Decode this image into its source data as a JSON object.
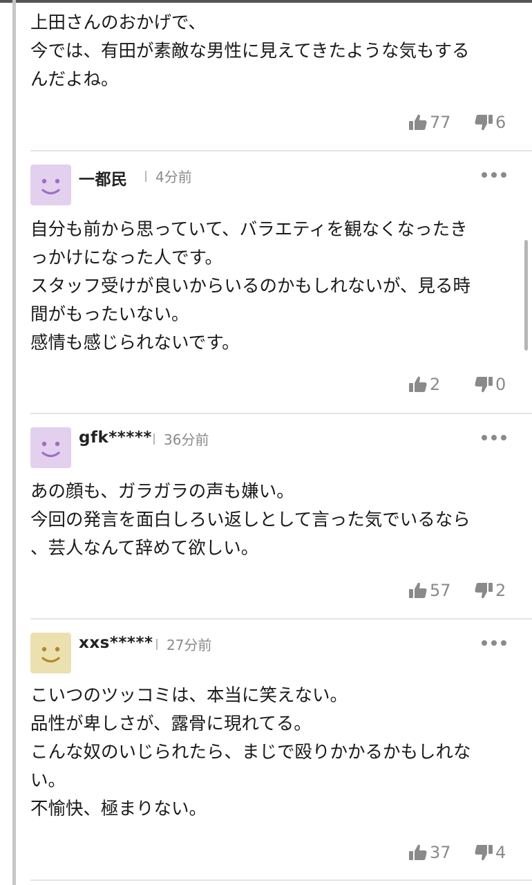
{
  "comments": [
    {
      "lines": [
        "上田さんのおかげで、",
        "今では、有田が素敵な男性に見えてきたような気もする",
        "んだよね。"
      ],
      "likes": "77",
      "dislikes": "6"
    },
    {
      "user": "一都民",
      "time": "4分前",
      "avatar_color": "#e3d0ee",
      "face_color": "#9c6ec6",
      "lines": [
        "自分も前から思っていて、バラエティを観なくなったき",
        "っかけになった人です。",
        "スタッフ受けが良いからいるのかもしれないが、見る時",
        "間がもったいない。",
        "感情も感じられないです。"
      ],
      "likes": "2",
      "dislikes": "0"
    },
    {
      "user": "gfk*****",
      "time": "36分前",
      "avatar_color": "#e3d0ee",
      "face_color": "#9c6ec6",
      "lines": [
        "あの顔も、ガラガラの声も嫌い。",
        "今回の発言を面白しろい返しとして言った気でいるなら",
        "、芸人なんて辞めて欲しい。"
      ],
      "likes": "57",
      "dislikes": "2"
    },
    {
      "user": "xxs*****",
      "time": "27分前",
      "avatar_color": "#ede0b0",
      "face_color": "#ad8a2c",
      "lines": [
        "こいつのツッコミは、本当に笑えない。",
        "品性が卑しさが、露骨に現れてる。",
        "こんな奴のいじられたら、まじで殴りかかるかもしれな",
        "い。",
        "不愉快、極まりない。"
      ],
      "likes": "37",
      "dislikes": "4"
    }
  ],
  "colors": {
    "text": "#1a1a1a",
    "muted": "#8a8a8a",
    "divider": "#e4e4e4"
  },
  "icons": {
    "like": "thumbs-up-icon",
    "dislike": "thumbs-down-icon",
    "more": "more-dots-icon"
  }
}
